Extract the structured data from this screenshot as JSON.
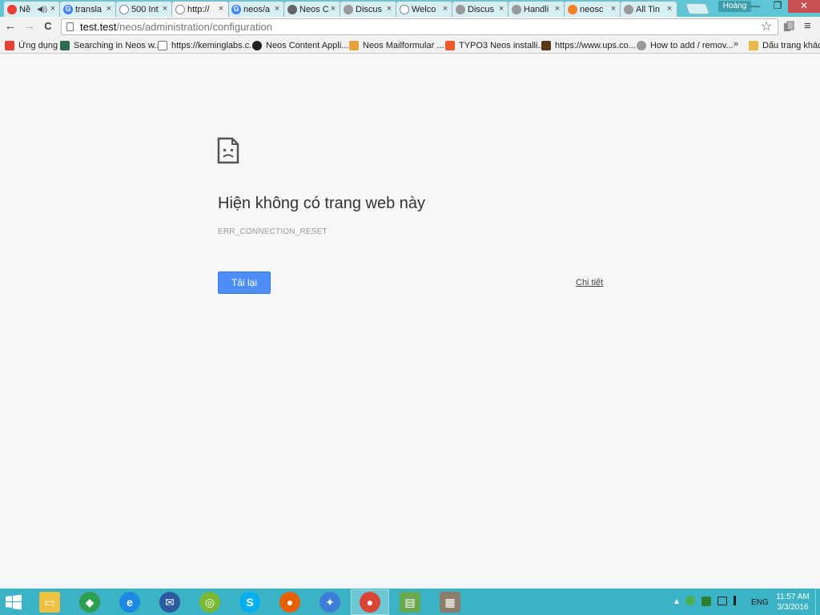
{
  "window": {
    "profile_name": "Hoàng",
    "minimize": "—",
    "restore": "❐",
    "close": "✕"
  },
  "tabs": [
    {
      "title": "Nề",
      "fav_color": "#e94235",
      "fav_glyph": "",
      "speaker": "◀))"
    },
    {
      "title": "transla",
      "fav_color": "#4285f4",
      "fav_glyph": "G"
    },
    {
      "title": "500 Int",
      "fav_color": "#ffffff",
      "fav_glyph": ""
    },
    {
      "title": "http://",
      "fav_color": "#ffffff",
      "fav_glyph": ""
    },
    {
      "title": "neos/a",
      "fav_color": "#4285f4",
      "fav_glyph": "G"
    },
    {
      "title": "Neos C",
      "fav_color": "#666666",
      "fav_glyph": ""
    },
    {
      "title": "Discus",
      "fav_color": "#999999",
      "fav_glyph": ""
    },
    {
      "title": "Welco",
      "fav_color": "#ffffff",
      "fav_glyph": ""
    },
    {
      "title": "Discus",
      "fav_color": "#999999",
      "fav_glyph": ""
    },
    {
      "title": "Handli",
      "fav_color": "#999999",
      "fav_glyph": ""
    },
    {
      "title": "neosc",
      "fav_color": "#f48024",
      "fav_glyph": ""
    },
    {
      "title": "All Tin",
      "fav_color": "#999999",
      "fav_glyph": ""
    }
  ],
  "toolbar": {
    "back": "←",
    "forward": "→",
    "reload": "C",
    "url_host": "test.test",
    "url_path": "/neos/administration/configuration",
    "star": "☆",
    "menu": "≡"
  },
  "bookmarks": {
    "items": [
      {
        "label": "Ứng dụng",
        "icon": "apps-icon",
        "color": "#e94235"
      },
      {
        "label": "Searching in Neos w...",
        "icon": "site-icon",
        "color": "#2d6a4f"
      },
      {
        "label": "https://keminglabs.c...",
        "icon": "page-icon",
        "color": "#ffffff"
      },
      {
        "label": "Neos Content Appli...",
        "icon": "github-icon",
        "color": "#222222"
      },
      {
        "label": "Neos Mailformular ...",
        "icon": "shield-icon",
        "color": "#e8a23a"
      },
      {
        "label": "TYPO3 Neos installi...",
        "icon": "typo3-icon",
        "color": "#f05a28"
      },
      {
        "label": "https://www.ups.co...",
        "icon": "ups-icon",
        "color": "#5a3a1a"
      },
      {
        "label": "How to add / remov...",
        "icon": "help-icon",
        "color": "#999999"
      }
    ],
    "overflow": "»",
    "other": "Dấu trang khác"
  },
  "error": {
    "title": "Hiện không có trang web này",
    "code": "ERR_CONNECTION_RESET",
    "reload_label": "Tải lại",
    "details_label": "Chi tiết"
  },
  "taskbar": {
    "apps": [
      {
        "name": "file-explorer",
        "color": "#f0c040",
        "glyph": "▭",
        "active": false
      },
      {
        "name": "maps",
        "color": "#2e9e4f",
        "glyph": "◆",
        "active": false
      },
      {
        "name": "internet-explorer",
        "color": "#1e88e5",
        "glyph": "e",
        "active": false
      },
      {
        "name": "thunderbird",
        "color": "#2c5aa0",
        "glyph": "✉",
        "active": false
      },
      {
        "name": "app-green",
        "color": "#79b933",
        "glyph": "◎",
        "active": false
      },
      {
        "name": "skype",
        "color": "#00aff0",
        "glyph": "S",
        "active": false
      },
      {
        "name": "firefox",
        "color": "#e66000",
        "glyph": "●",
        "active": false
      },
      {
        "name": "safari",
        "color": "#3b7dd8",
        "glyph": "✦",
        "active": false
      },
      {
        "name": "chrome",
        "color": "#db4437",
        "glyph": "●",
        "active": true
      },
      {
        "name": "tasks",
        "color": "#6aa84f",
        "glyph": "▤",
        "active": false
      },
      {
        "name": "firewall",
        "color": "#8e7d6b",
        "glyph": "▦",
        "active": false
      }
    ],
    "tray": {
      "up_arrow": "▲",
      "lang": "ENG",
      "time": "11:57 AM",
      "date": "3/3/2016"
    }
  }
}
